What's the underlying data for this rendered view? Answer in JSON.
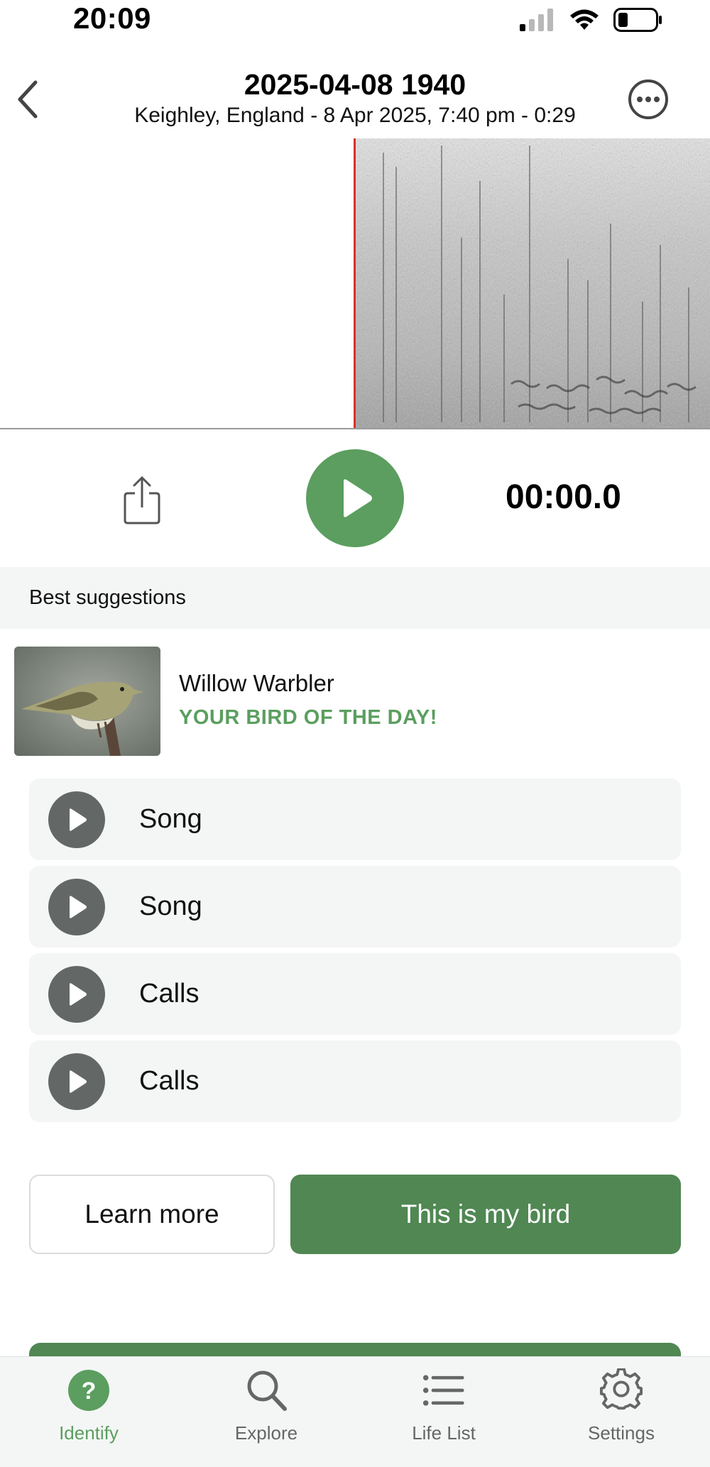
{
  "status_bar": {
    "time": "20:09",
    "icons": [
      "signal-icon",
      "wifi-icon",
      "battery-icon"
    ]
  },
  "header": {
    "title": "2025-04-08 1940",
    "subtitle": "Keighley, England - 8 Apr 2025, 7:40 pm - 0:29",
    "back_icon": "chevron-left-icon",
    "more_icon": "more-icon"
  },
  "player": {
    "elapsed": "00:00.0",
    "share_icon": "share-icon",
    "play_icon": "play-icon"
  },
  "suggestions": {
    "title": "Best suggestions",
    "top": {
      "name": "Willow Warbler",
      "tag": "YOUR BIRD OF THE DAY!"
    },
    "sounds": [
      {
        "label": "Song"
      },
      {
        "label": "Song"
      },
      {
        "label": "Calls"
      },
      {
        "label": "Calls"
      }
    ]
  },
  "actions": {
    "learn_more": "Learn more",
    "confirm": "This is my bird"
  },
  "tabs": [
    {
      "label": "Identify",
      "icon": "question-icon",
      "active": true
    },
    {
      "label": "Explore",
      "icon": "search-icon",
      "active": false
    },
    {
      "label": "Life List",
      "icon": "list-icon",
      "active": false
    },
    {
      "label": "Settings",
      "icon": "gear-icon",
      "active": false
    }
  ],
  "colors": {
    "accent": "#5b9e5f",
    "accent_dark": "#508753",
    "playhead": "#d9302b",
    "surface": "#f4f6f5"
  }
}
